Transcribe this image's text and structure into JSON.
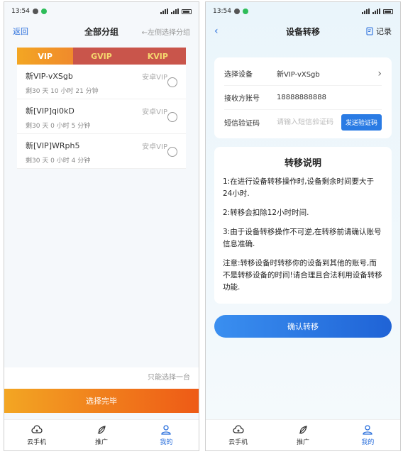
{
  "left": {
    "status": {
      "time": "13:54"
    },
    "nav": {
      "back": "返回",
      "title": "全部分组",
      "hint": "←左侧选择分组"
    },
    "tabs": [
      {
        "label": "VIP",
        "active": true
      },
      {
        "label": "GVIP",
        "active": false
      },
      {
        "label": "KVIP",
        "active": false
      }
    ],
    "devices": [
      {
        "name": "新VIP-vXSgb",
        "type": "安卓VIP",
        "remaining": "剩30 天 10 小时 21 分钟"
      },
      {
        "name": "新[VIP]qi0kD",
        "type": "安卓VIP",
        "remaining": "剩30 天 0 小时 5 分钟"
      },
      {
        "name": "新[VIP]WRph5",
        "type": "安卓VIP",
        "remaining": "剩30 天 0 小时 4 分钟"
      }
    ],
    "only_one": "只能选择一台",
    "finish": "选择完毕",
    "bottom_nav": [
      {
        "label": "云手机",
        "icon": "cloud-phone-icon",
        "active": false
      },
      {
        "label": "推广",
        "icon": "promote-icon",
        "active": false
      },
      {
        "label": "我的",
        "icon": "user-icon",
        "active": true
      }
    ]
  },
  "right": {
    "status": {
      "time": "13:54"
    },
    "nav": {
      "title": "设备转移",
      "record": "记录"
    },
    "form": {
      "device_label": "选择设备",
      "device_value": "新VIP-vXSgb",
      "account_label": "接收方账号",
      "account_value": "18888888888",
      "sms_label": "短信验证码",
      "sms_placeholder": "请输入短信验证码",
      "send_code": "发送验证码"
    },
    "info": {
      "title": "转移说明",
      "items": [
        "1:在进行设备转移操作时,设备剩余时间要大于24小时.",
        "2:转移会扣除12小时时间.",
        "3:由于设备转移操作不可逆,在转移前请确认账号信息准确.",
        "注意:转移设备时转移你的设备到其他的账号,而不是转移设备的时间!请合理且合法利用设备转移功能."
      ]
    },
    "confirm": "确认转移",
    "bottom_nav": [
      {
        "label": "云手机",
        "icon": "cloud-phone-icon",
        "active": false
      },
      {
        "label": "推广",
        "icon": "promote-icon",
        "active": false
      },
      {
        "label": "我的",
        "icon": "user-icon",
        "active": true
      }
    ]
  },
  "colors": {
    "accent_blue": "#2a6fdc",
    "vip_orange": "#f3a623",
    "tab_red": "#c9554b"
  }
}
